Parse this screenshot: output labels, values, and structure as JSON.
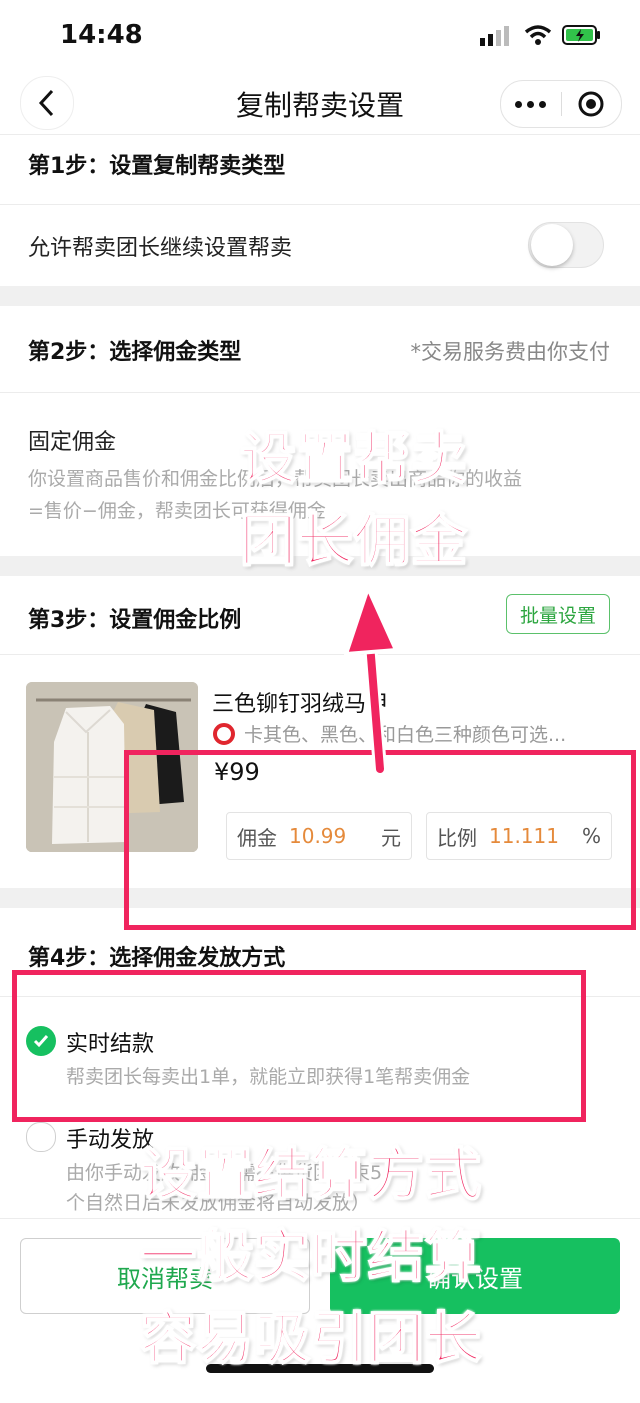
{
  "status_bar": {
    "time": "14:48"
  },
  "nav": {
    "title": "复制帮卖设置"
  },
  "step1": {
    "title": "第1步：设置复制帮卖类型",
    "toggle_label": "允许帮卖团长继续设置帮卖",
    "toggle_on": false
  },
  "step2": {
    "title": "第2步：选择佣金类型",
    "note": "*交易服务费由你支付",
    "option_title": "固定佣金",
    "desc_line1": "你设置商品售价和佣金比例后，帮卖团长卖出商品你的收益",
    "desc_line2": "=售价−佣金，帮卖团长可获得佣金"
  },
  "step3": {
    "title": "第3步：设置佣金比例",
    "batch_button": "批量设置",
    "product": {
      "name": "三色铆钉羽绒马甲",
      "desc": "卡其色、黑色、和白色三种颜色可选...",
      "price": "¥99",
      "commission_label": "佣金",
      "commission_value": "10.99",
      "commission_unit": "元",
      "ratio_label": "比例",
      "ratio_value": "11.111",
      "ratio_unit": "%"
    }
  },
  "step4": {
    "title": "第4步：选择佣金发放方式",
    "options": [
      {
        "label": "实时结款",
        "desc": "帮卖团长每卖出1单，就能立即获得1笔帮卖佣金",
        "selected": true
      },
      {
        "label": "手动发放",
        "desc_line1": "由你手动发放佣金（需在供货团结束5",
        "desc_line2": "个自然日后未发放佣金将自动发放）",
        "selected": false
      }
    ]
  },
  "footer": {
    "cancel": "取消帮卖",
    "confirm": "确认设置"
  },
  "overlay": {
    "text1_line1": "设置帮卖",
    "text1_line2": "团长佣金",
    "text2_line1": "设置结算方式",
    "text2_line2": "一般实时结算",
    "text2_line3": "容易吸引团长"
  },
  "colors": {
    "accent_green": "#16c060",
    "highlight_red": "#f0245e",
    "value_orange": "#e58a3b"
  }
}
